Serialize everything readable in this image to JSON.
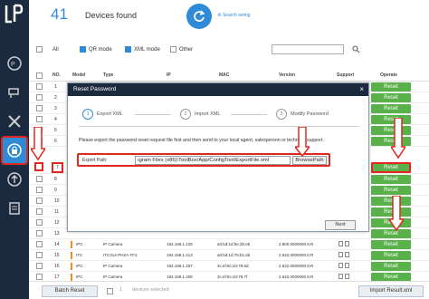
{
  "header": {
    "device_count": "41",
    "devices_found": "Devices found",
    "search_setting": "Search seting"
  },
  "filters": {
    "all": "All",
    "qr_mode": "QR mode",
    "xml_mode": "XML mode",
    "other": "Other"
  },
  "table": {
    "headers": [
      "NO.",
      "Model",
      "Type",
      "IP",
      "MAC",
      "Version",
      "Support",
      "Operate"
    ],
    "reset_label": "Reset",
    "rows": [
      {
        "no": "1"
      },
      {
        "no": "2"
      },
      {
        "no": "3"
      },
      {
        "no": "4"
      },
      {
        "no": "5"
      },
      {
        "no": "6"
      },
      {
        "no": "7"
      },
      {
        "no": "8"
      },
      {
        "no": "9"
      },
      {
        "no": "10"
      },
      {
        "no": "11"
      },
      {
        "no": "12"
      },
      {
        "no": "13"
      },
      {
        "no": "14",
        "model": "IPC",
        "type": "IP Camera",
        "ip": "192.168.1.129",
        "mac": "a0:bd:1d:be:2b:eb",
        "version": "2.800.0000000.8.R"
      },
      {
        "no": "15",
        "model": "ITC",
        "type": "ITC314-PH2A-TF2",
        "ip": "192.168.1.213",
        "mac": "a0:bd:1d:75:b1:ab",
        "version": "2.622.0000000.0.R"
      },
      {
        "no": "16",
        "model": "IPC",
        "type": "IP Camera",
        "ip": "192.168.1.207",
        "mac": "3c:ef:8c:d4:78:6d",
        "version": "2.622.0000000.8.R"
      },
      {
        "no": "17",
        "model": "IPC",
        "type": "IP Camera",
        "ip": "192.168.1.208",
        "mac": "3c:ef:8c:d4:78:7f",
        "version": "2.622.0000000.8.R"
      }
    ]
  },
  "modal": {
    "title": "Reset Password",
    "close": "×",
    "steps": [
      {
        "num": "1",
        "label": "Export XML"
      },
      {
        "num": "2",
        "label": "Import XML"
      },
      {
        "num": "3",
        "label": "Modify Password"
      }
    ],
    "description": "Please export the password reset request file first and then send to your local agent, salesperson or technical support.",
    "export_label": "Export Path:",
    "export_path": "ıgram Files (x86)\\ToolBox/App/ConfigTool/ExportFile.xml",
    "browse": "BrowsePath",
    "next": "Next"
  },
  "footer": {
    "batch_reset": "Batch Reset",
    "selected_count": "1",
    "selected_text": "devices selected",
    "import_result": "Import Result.xml"
  },
  "colors": {
    "accent": "#2f8ad8",
    "reset_green": "#5ab14a",
    "highlight_red": "#e0281f",
    "sidebar": "#1b2a3e"
  }
}
